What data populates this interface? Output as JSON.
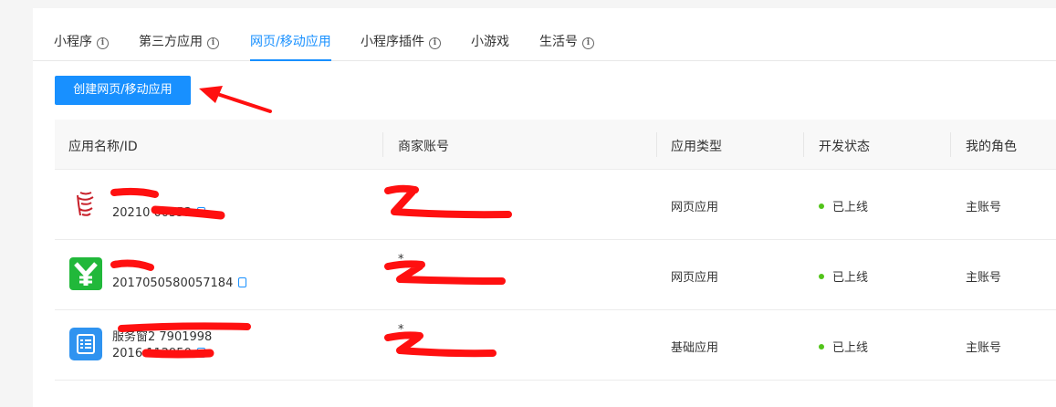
{
  "tabs": [
    {
      "label": "小程序",
      "info": "i",
      "active": false
    },
    {
      "label": "第三方应用",
      "info": "i",
      "active": false
    },
    {
      "label": "网页/移动应用",
      "active": true
    },
    {
      "label": "小程序插件",
      "info": "i",
      "active": false
    },
    {
      "label": "小游戏",
      "active": false
    },
    {
      "label": "生活号",
      "info": "i",
      "active": false
    }
  ],
  "create_button": "创建网页/移动应用",
  "table": {
    "headers": [
      "应用名称/ID",
      "商家账号",
      "应用类型",
      "开发状态",
      "我的角色"
    ],
    "rows": [
      {
        "icon": "red-seal-icon",
        "name": "",
        "id": "20210          00353",
        "merchant_name": "",
        "merchant_account": "",
        "type": "网页应用",
        "status": "已上线",
        "role": "主账号"
      },
      {
        "icon": "green-y-icon",
        "name": "",
        "id": "2017050580057184",
        "merchant_name": "*",
        "merchant_account": "",
        "type": "网页应用",
        "status": "已上线",
        "role": "主账号"
      },
      {
        "icon": "blue-document-icon",
        "name": "服务窗2           7901998",
        "id": "2016      112950",
        "merchant_name": "*",
        "merchant_account": "",
        "type": "基础应用",
        "status": "已上线",
        "role": "主账号"
      }
    ]
  },
  "colors": {
    "accent": "#1890ff",
    "status_dot": "#52c41a",
    "annotation": "#ff0000"
  }
}
